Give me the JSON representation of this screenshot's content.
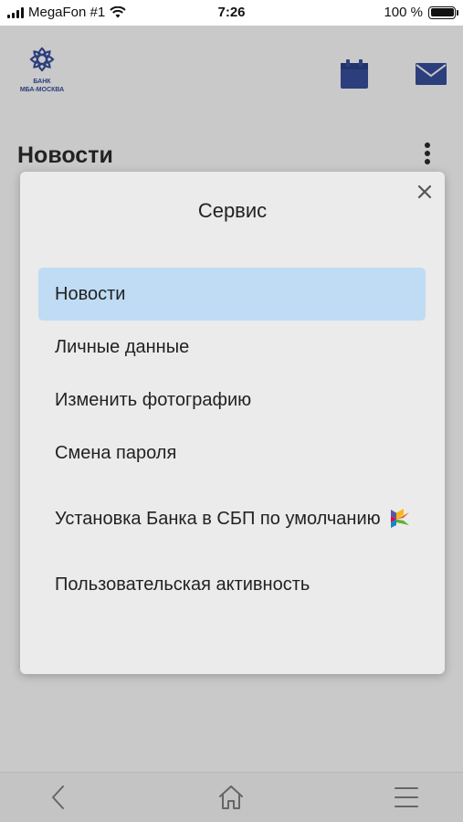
{
  "status_bar": {
    "carrier": "MegaFon #1",
    "time": "7:26",
    "battery": "100 %"
  },
  "header": {
    "logo_line1": "БАНК",
    "logo_line2": "МБА-МОСКВА"
  },
  "page": {
    "title": "Новости"
  },
  "modal": {
    "title": "Сервис",
    "items": [
      {
        "label": "Новости",
        "active": true
      },
      {
        "label": "Личные данные"
      },
      {
        "label": "Изменить фотографию"
      },
      {
        "label": "Смена пароля"
      },
      {
        "label": "Установка Банка в СБП по умолчанию",
        "icon": "sbp-icon"
      },
      {
        "label": "Пользовательская активность"
      }
    ]
  },
  "icons": {
    "calendar": "calendar-icon",
    "mail": "mail-icon",
    "more": "more-vertical-icon",
    "close": "close-icon",
    "back": "back-arrow-icon",
    "home": "home-icon",
    "menu": "hamburger-menu-icon"
  },
  "colors": {
    "brand": "#2c3f7c",
    "active_item_bg": "#bfdcf4",
    "modal_bg": "#ebebeb",
    "overlay_bg": "#c9c9c9"
  }
}
